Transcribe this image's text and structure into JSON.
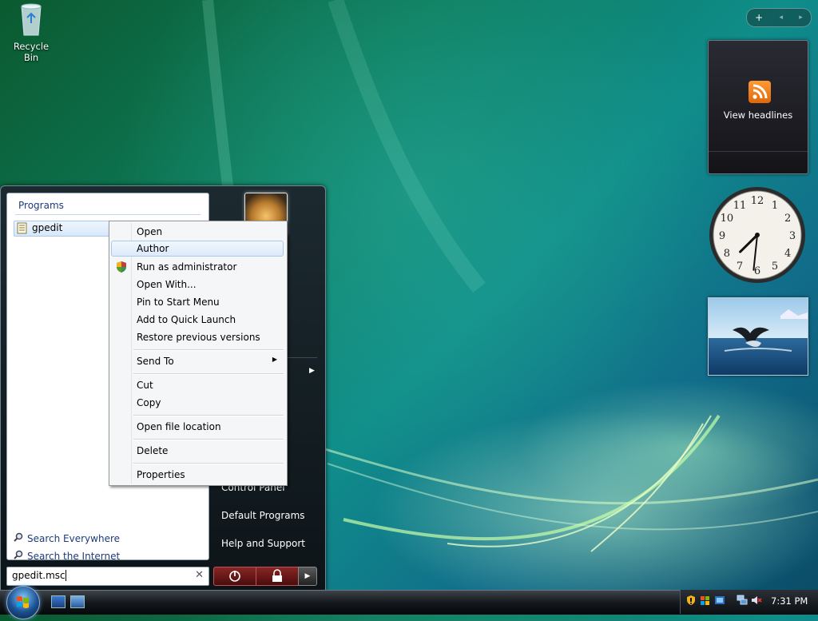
{
  "desktop": {
    "recycle_bin_label": "Recycle Bin"
  },
  "sidebar": {
    "controls": [
      "+",
      "◂",
      "▸"
    ],
    "feed_gadget_label": "View headlines",
    "clock_numbers": [
      "12",
      "1",
      "2",
      "3",
      "4",
      "5",
      "6",
      "7",
      "8",
      "9",
      "10",
      "11"
    ],
    "clock_time": "7:31"
  },
  "start_menu": {
    "programs_header": "Programs",
    "program_item": "gpedit",
    "search_everywhere": "Search Everywhere",
    "search_internet": "Search the Internet",
    "search_value": "gpedit.msc",
    "search_clear": "✕",
    "right_links": {
      "control_panel": "Control Panel",
      "default_programs": "Default Programs",
      "help_support": "Help and Support"
    }
  },
  "context_menu": {
    "items": [
      "Open",
      "Author",
      "Run as administrator",
      "Open With...",
      "Pin to Start Menu",
      "Add to Quick Launch",
      "Restore previous versions",
      "Send To",
      "Cut",
      "Copy",
      "Open file location",
      "Delete",
      "Properties"
    ],
    "highlighted": "Author"
  },
  "taskbar": {
    "clock": "7:31 PM"
  },
  "colors": {
    "menu_highlight": "#dbeafc",
    "power_button": "#8a2525",
    "link_blue": "#1e3b7a"
  }
}
